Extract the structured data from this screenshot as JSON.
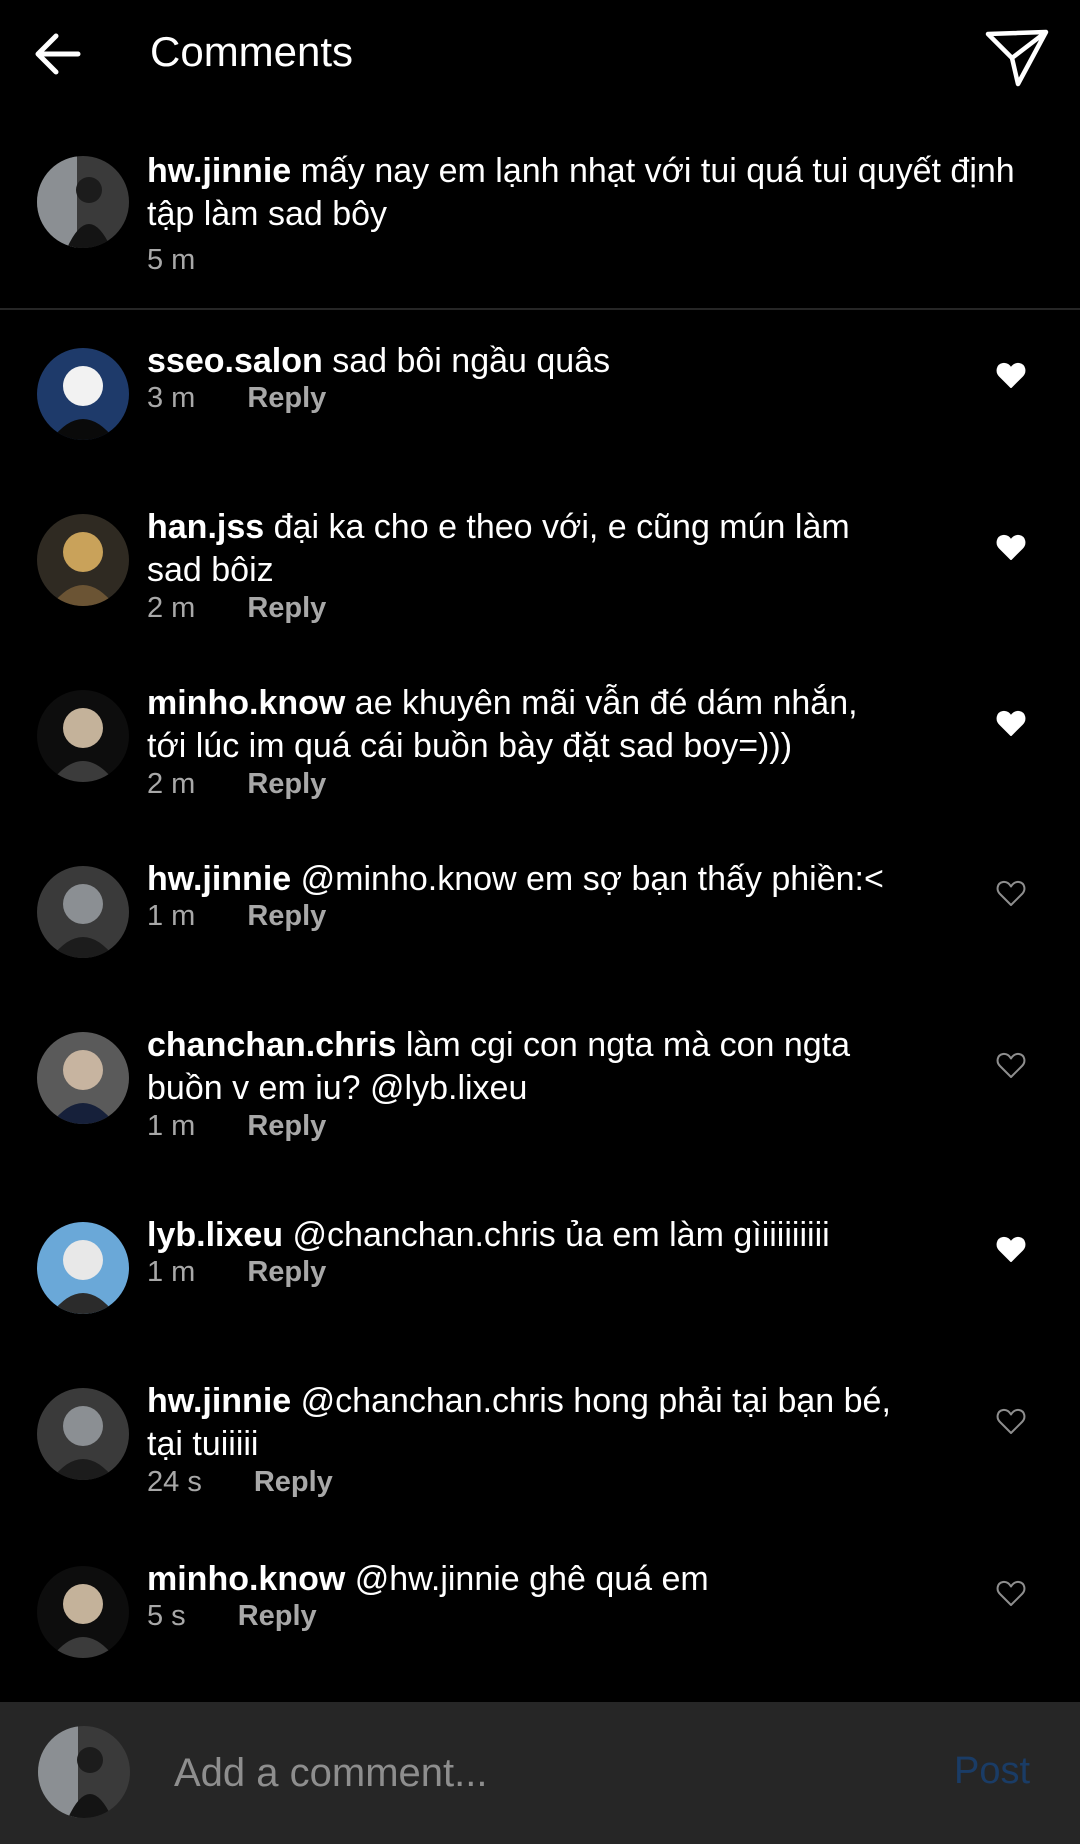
{
  "header": {
    "title": "Comments",
    "back_icon": "arrow-left-icon",
    "share_icon": "send-icon"
  },
  "caption": {
    "username": "hw.jinnie",
    "text": "mấy nay em lạnh nhạt với tui quá tui quyết định",
    "text_line2": "tập làm sad bôy",
    "time": "5 m"
  },
  "comments": [
    {
      "username": "sseo.salon",
      "text": "sad bôi ngầu quâs",
      "text_line2": "",
      "time": "3 m",
      "reply": "Reply",
      "liked": true
    },
    {
      "username": "han.jss",
      "text": "đại ka cho e theo với, e cũng mún làm",
      "text_line2": "sad bôiz",
      "time": "2 m",
      "reply": "Reply",
      "liked": true
    },
    {
      "username": "minho.know",
      "text": "ae khuyên mãi vẫn đé dám nhắn,",
      "text_line2": "tới lúc im quá cái buồn bày đặt sad boy=)))",
      "time": "2 m",
      "reply": "Reply",
      "liked": true
    },
    {
      "username": "hw.jinnie",
      "text": "@minho.know em sợ bạn thấy phiền:<",
      "text_line2": "",
      "time": "1 m",
      "reply": "Reply",
      "liked": false
    },
    {
      "username": "chanchan.chris",
      "text": "làm cgi con ngta mà con ngta",
      "text_line2": "buồn v em iu? @lyb.lixeu",
      "time": "1 m",
      "reply": "Reply",
      "liked": false
    },
    {
      "username": "lyb.lixeu",
      "text": "@chanchan.chris ủa em làm gìiiiiiiiii",
      "text_line2": "",
      "time": "1 m",
      "reply": "Reply",
      "liked": true
    },
    {
      "username": "hw.jinnie",
      "text": "@chanchan.chris hong phải tại bạn bé,",
      "text_line2": "tại tuiiiii",
      "time": "24 s",
      "reply": "Reply",
      "liked": false
    },
    {
      "username": "minho.know",
      "text": "@hw.jinnie ghê quá em",
      "text_line2": "",
      "time": "5 s",
      "reply": "Reply",
      "liked": false
    }
  ],
  "composer": {
    "placeholder": "Add a comment...",
    "post_label": "Post",
    "post_color": "#1a3c66"
  },
  "colors": {
    "background": "#000000",
    "muted": "#a8a8a8",
    "divider": "#262626",
    "composer_bg": "#262626"
  }
}
